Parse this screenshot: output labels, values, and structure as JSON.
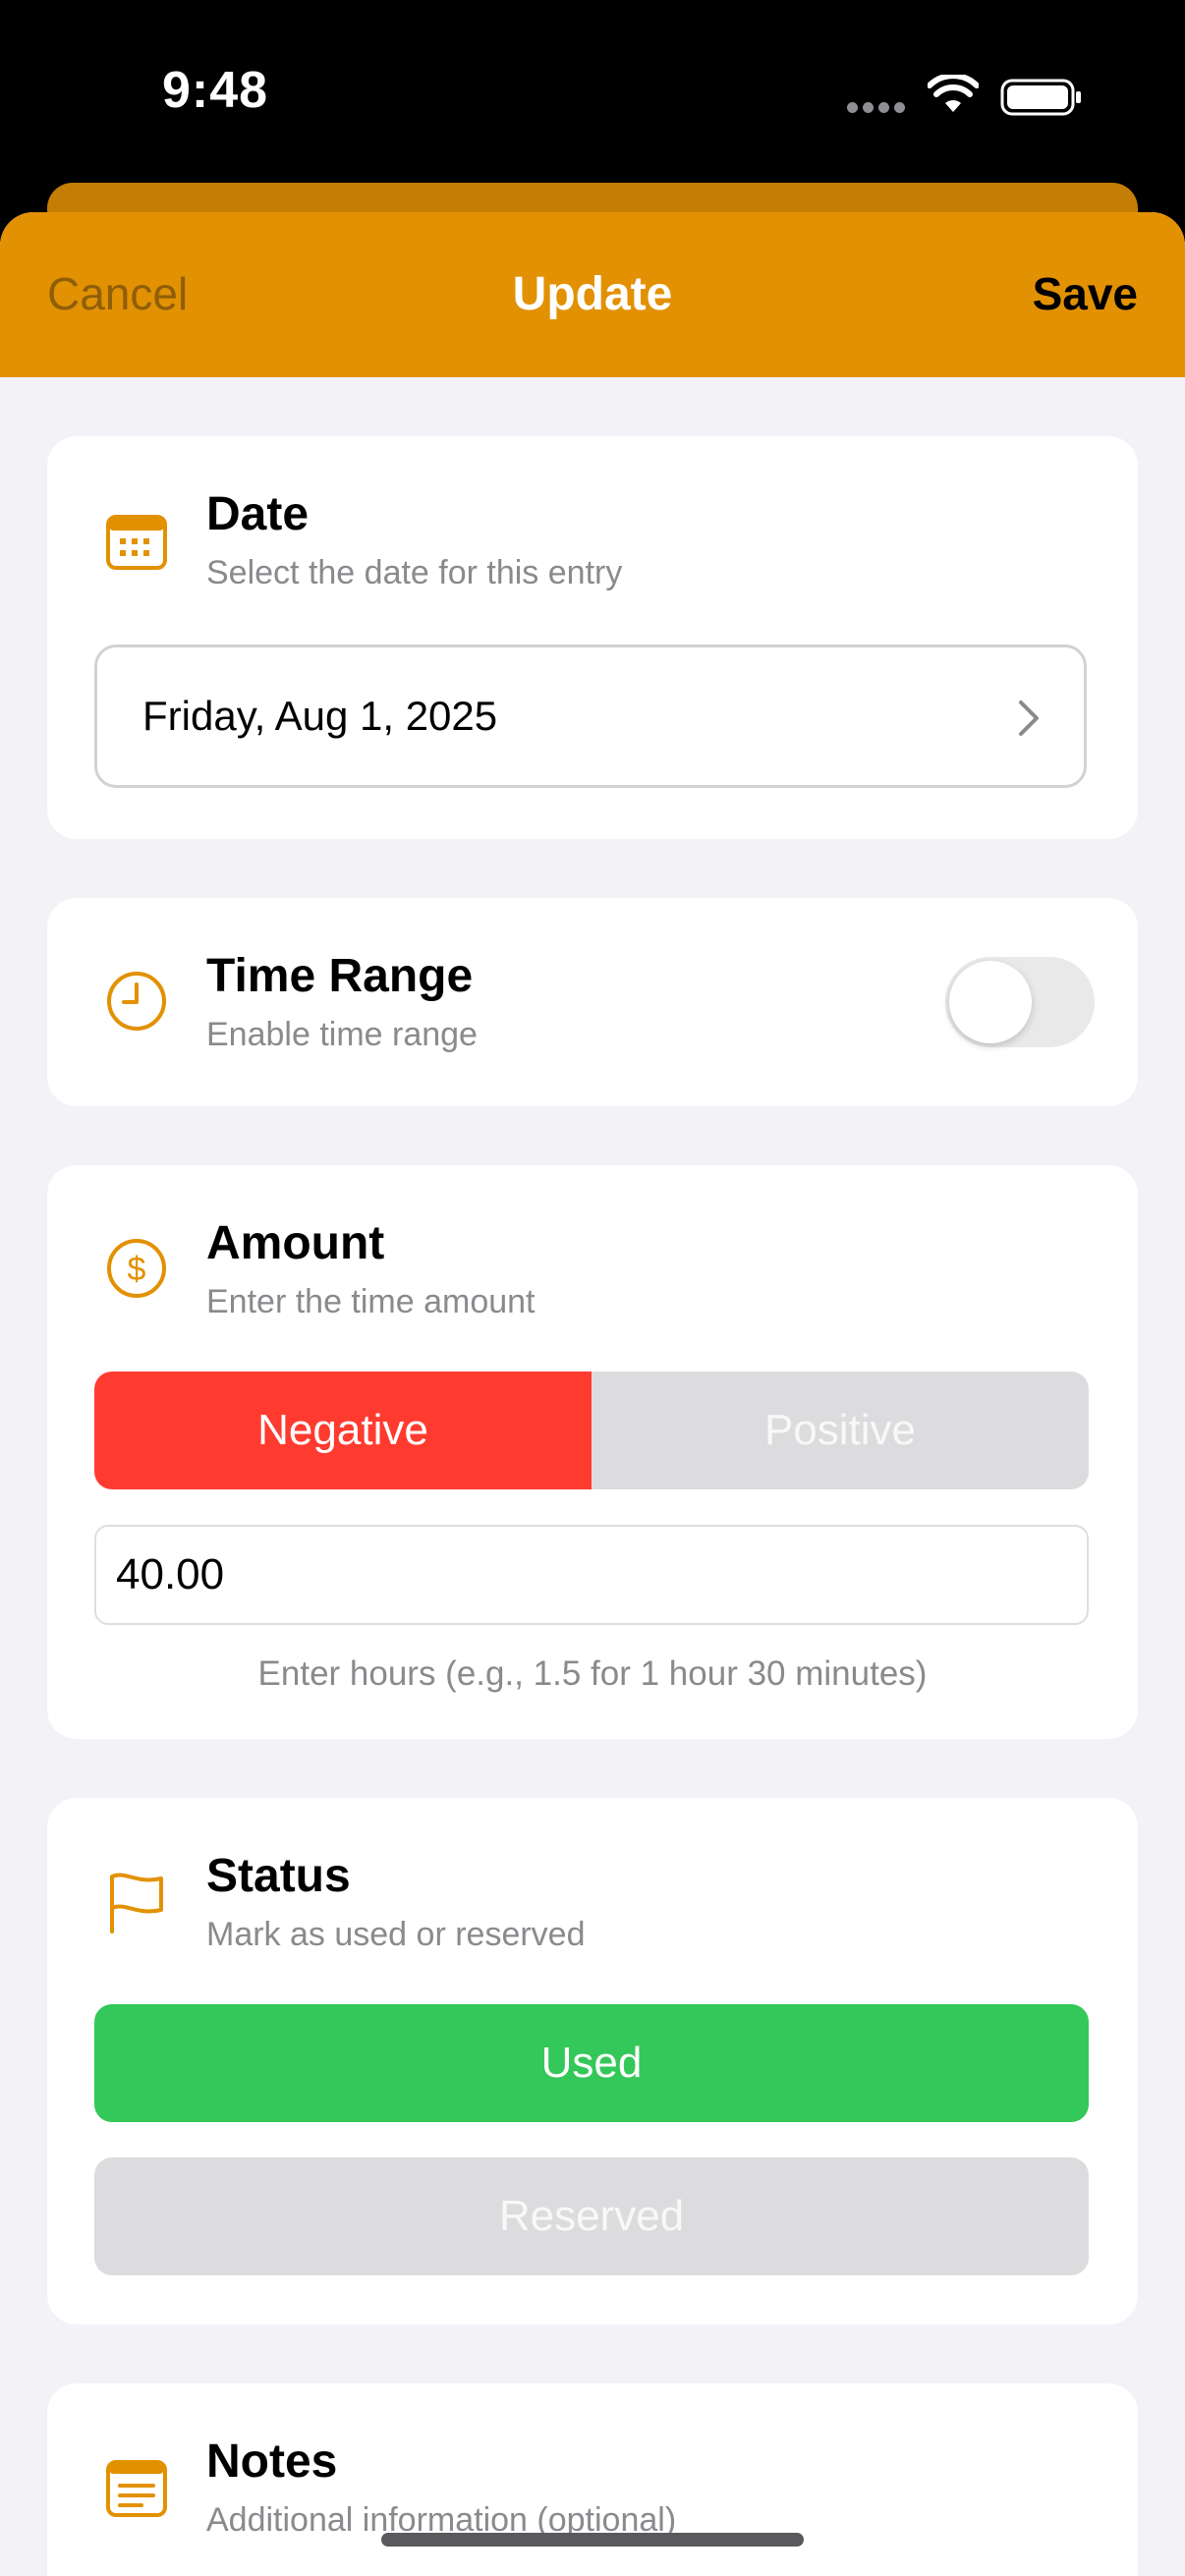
{
  "status": {
    "time": "9:48"
  },
  "nav": {
    "cancel": "Cancel",
    "title": "Update",
    "save": "Save"
  },
  "date_card": {
    "title": "Date",
    "subtitle": "Select the date for this entry",
    "value": "Friday, Aug 1, 2025",
    "icon": "calendar-icon"
  },
  "time_range_card": {
    "title": "Time Range",
    "subtitle": "Enable time range",
    "enabled": false,
    "icon": "clock-icon"
  },
  "amount_card": {
    "title": "Amount",
    "subtitle": "Enter the time amount",
    "negative_label": "Negative",
    "positive_label": "Positive",
    "selected_sign": "Negative",
    "value": "40.00",
    "hint": "Enter hours (e.g., 1.5 for 1 hour 30 minutes)",
    "icon": "dollar-icon"
  },
  "status_card": {
    "title": "Status",
    "subtitle": "Mark as used or reserved",
    "used_label": "Used",
    "reserved_label": "Reserved",
    "selected": "Used",
    "icon": "flag-icon"
  },
  "notes_card": {
    "title": "Notes",
    "subtitle": "Additional information (optional)",
    "icon": "notes-icon"
  },
  "colors": {
    "accent": "#e29103",
    "negative": "#ff3b30",
    "used": "#34c759",
    "inactive": "#dcdcdf",
    "background": "#f2f2f7"
  }
}
